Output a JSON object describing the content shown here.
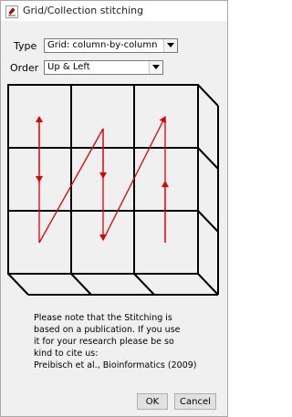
{
  "window": {
    "title": "Grid/Collection stitching"
  },
  "form": {
    "type_label": "Type",
    "type_value": "Grid: column-by-column",
    "order_label": "Order",
    "order_value": "Up & Left"
  },
  "note": {
    "lines": [
      "Please note that the Stitching is",
      "based on a publication. If you use",
      "it for your research please be so",
      "kind to cite us:",
      "Preibisch et al., Bioinformatics (2009)"
    ]
  },
  "buttons": {
    "ok": "OK",
    "cancel": "Cancel"
  },
  "colors": {
    "arrow": "#e00000",
    "grid_line": "#000000",
    "background": "#f0f0f0"
  },
  "icons": {
    "app": "imagej-microscope-icon",
    "dropdown": "chevron-down-icon"
  }
}
